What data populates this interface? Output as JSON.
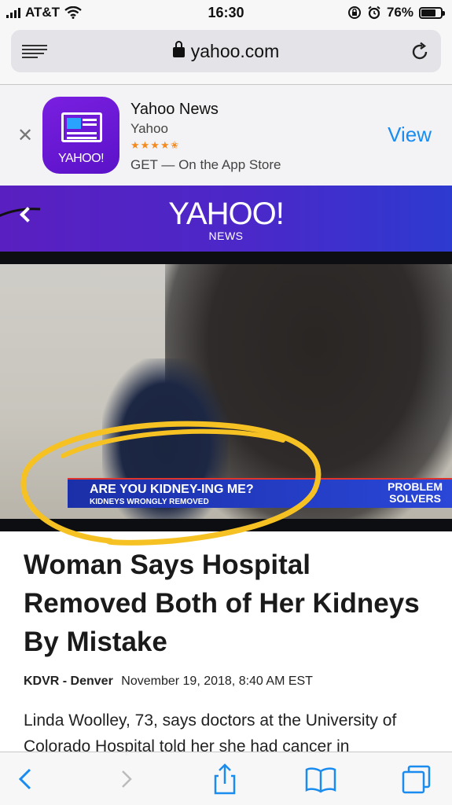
{
  "status": {
    "carrier": "AT&T",
    "time": "16:30",
    "battery": "76%",
    "battery_level": 0.76
  },
  "browser": {
    "url": "yahoo.com"
  },
  "app_banner": {
    "app_name": "Yahoo News",
    "developer": "Yahoo",
    "stars": "★★★★✬",
    "cta_text": "GET — On the App Store",
    "view_label": "View",
    "close_label": "✕",
    "icon_brand": "YAHOO!"
  },
  "site_header": {
    "logo": "YAHOO!",
    "section": "NEWS"
  },
  "video": {
    "headline_banner": "ARE YOU KIDNEY-ING ME?",
    "sub_banner": "KIDNEYS WRONGLY REMOVED",
    "segment_line1": "PROBLEM",
    "segment_line2": "SOLVERS"
  },
  "article": {
    "title": "Woman Says Hospital Removed Both of Her Kidneys By Mistake",
    "source": "KDVR - Denver",
    "date": "November 19, 2018, 8:40 AM EST",
    "body_start": "Linda Woolley, 73, says doctors at the University of Colorado Hospital told her she had cancer in"
  },
  "colors": {
    "yahoo_purple": "#5a1fc0",
    "link_blue": "#1a8cf0",
    "annotation_yellow": "#f6c223"
  }
}
